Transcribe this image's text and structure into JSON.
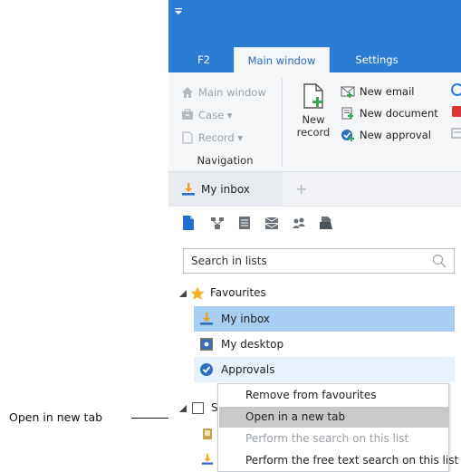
{
  "callout": {
    "label": "Open in new tab"
  },
  "ribbon_tabs": [
    {
      "label": "F2",
      "active": false
    },
    {
      "label": "Main window",
      "active": true
    },
    {
      "label": "Settings",
      "active": false
    }
  ],
  "navigation": {
    "items": [
      {
        "label": "Main window",
        "icon": "home-icon"
      },
      {
        "label": "Case ▾",
        "icon": "case-icon"
      },
      {
        "label": "Record ▾",
        "icon": "record-icon"
      }
    ],
    "group_label": "Navigation"
  },
  "new_record": {
    "label_line1": "New",
    "label_line2": "record"
  },
  "new_items": [
    {
      "label": "New email",
      "icon": "email-icon"
    },
    {
      "label": "New document",
      "icon": "document-icon"
    },
    {
      "label": "New approval",
      "icon": "approval-icon"
    }
  ],
  "doc_tab": {
    "label": "My inbox",
    "add_symbol": "+"
  },
  "search": {
    "placeholder": "Search in lists"
  },
  "tree": {
    "favourites_label": "Favourites",
    "items": [
      {
        "label": "My inbox",
        "state": "selected"
      },
      {
        "label": "My desktop",
        "state": "normal"
      },
      {
        "label": "Approvals",
        "state": "hover"
      }
    ],
    "second_group_letter": "S"
  },
  "context_menu": {
    "items": [
      {
        "label": "Remove from favourites",
        "state": "normal"
      },
      {
        "label": "Open in a new tab",
        "state": "highlighted"
      },
      {
        "label": "Perform the search on this list",
        "state": "disabled"
      },
      {
        "label": "Perform the free text search on this list",
        "state": "normal"
      }
    ]
  },
  "colors": {
    "ribbon_blue": "#2b7cd3",
    "selection": "#a9cdf0",
    "menu_highlight": "#c9c9c9",
    "accent_blue": "#1f6fd0",
    "green": "#3aa655",
    "star": "#f2b01e"
  }
}
